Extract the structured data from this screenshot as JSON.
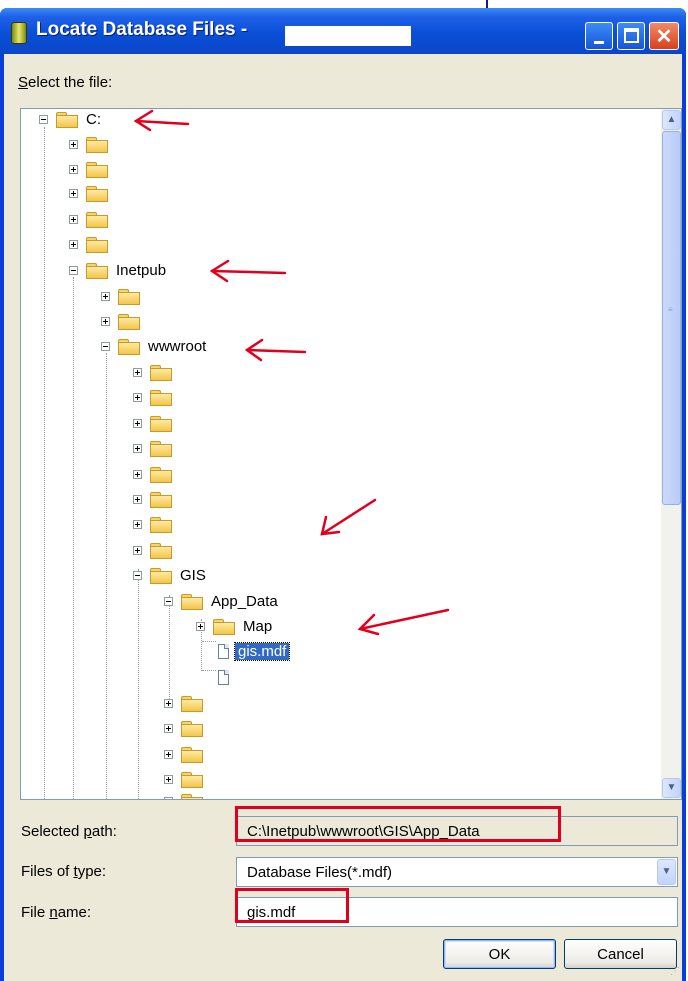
{
  "window": {
    "title": "Locate Database Files - "
  },
  "dialog": {
    "select_label_first": "S",
    "select_label_rest": "elect the file:",
    "selected_path_label_pre": "Selected ",
    "selected_path_label_u": "p",
    "selected_path_label_post": "ath:",
    "selected_path_value": "C:\\Inetpub\\wwwroot\\GIS\\App_Data",
    "files_of_type_label_pre": "Files of ",
    "files_of_type_label_u": "t",
    "files_of_type_label_post": "ype:",
    "files_of_type_value": "Database Files(*.mdf)",
    "file_name_label_pre": "File ",
    "file_name_label_u": "n",
    "file_name_label_post": "ame:",
    "file_name_value": "gis.mdf",
    "ok_label": "OK",
    "cancel_label": "Cancel"
  },
  "tree": {
    "drive": "C:",
    "inetpub": "Inetpub",
    "wwwroot": "wwwroot",
    "gis": "GIS",
    "app_data": "App_Data",
    "map": "Map",
    "selected_file": "gis.mdf"
  },
  "colors": {
    "annotation_red": "#e0001e",
    "title_blue": "#0a4fd8",
    "selection": "#316ac5"
  },
  "icons": [
    "app-database-icon",
    "minimize-icon",
    "maximize-icon",
    "close-icon",
    "folder-icon",
    "file-icon",
    "expand-plus-icon",
    "collapse-minus-icon",
    "scroll-up-icon",
    "scroll-down-icon",
    "dropdown-arrow-icon",
    "annotation-arrow-icon"
  ]
}
